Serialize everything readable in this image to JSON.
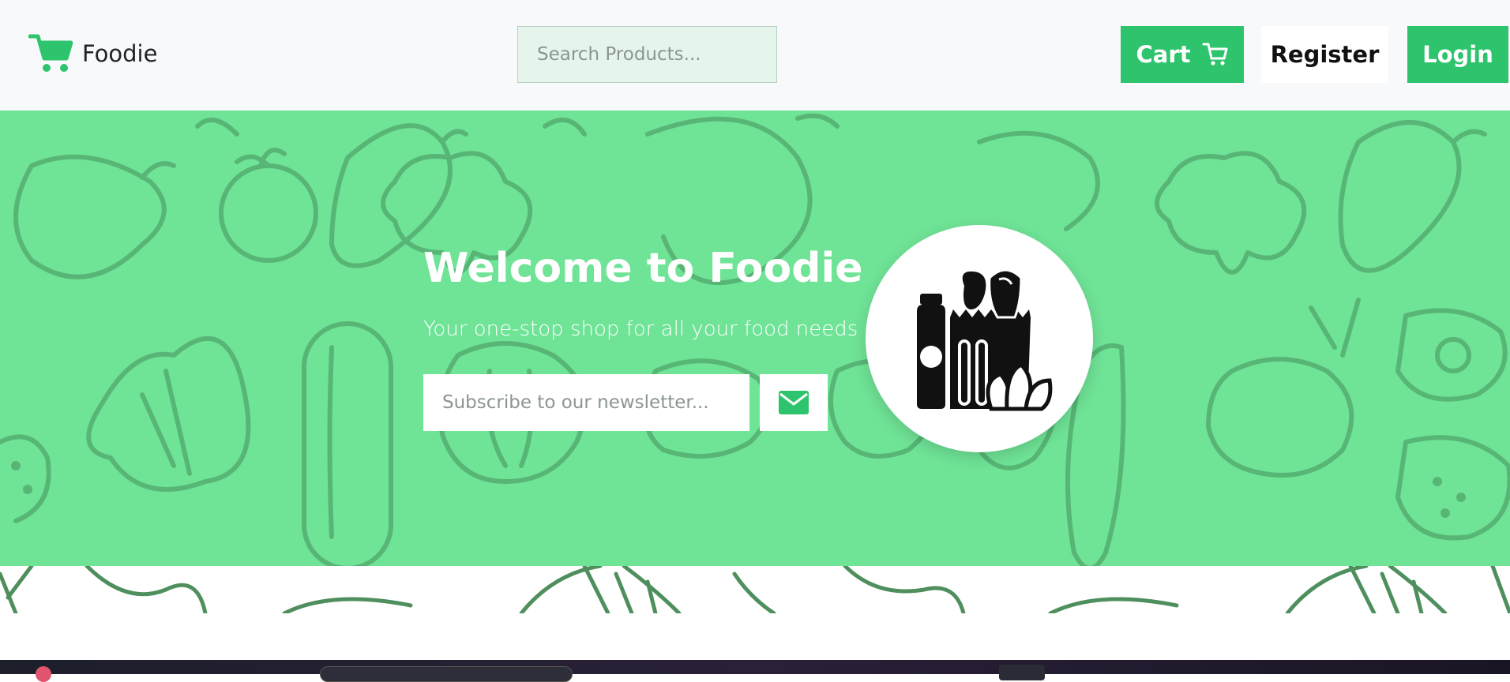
{
  "navbar": {
    "brand_name": "Foodie",
    "search_placeholder": "Search Products...",
    "cart_label": "Cart",
    "register_label": "Register",
    "login_label": "Login"
  },
  "hero": {
    "title": "Welcome to Foodie",
    "subtitle": "Your one-stop shop for all your food needs",
    "newsletter_placeholder": "Subscribe to our newsletter...",
    "icons": {
      "subscribe": "envelope-icon",
      "illustration": "grocery-bag-icon"
    }
  },
  "colors": {
    "brand_green": "#2ec46d",
    "hero_bg": "#6fe396",
    "pattern_stroke": "#4fa86c",
    "navbar_bg": "#f8f9fb"
  }
}
